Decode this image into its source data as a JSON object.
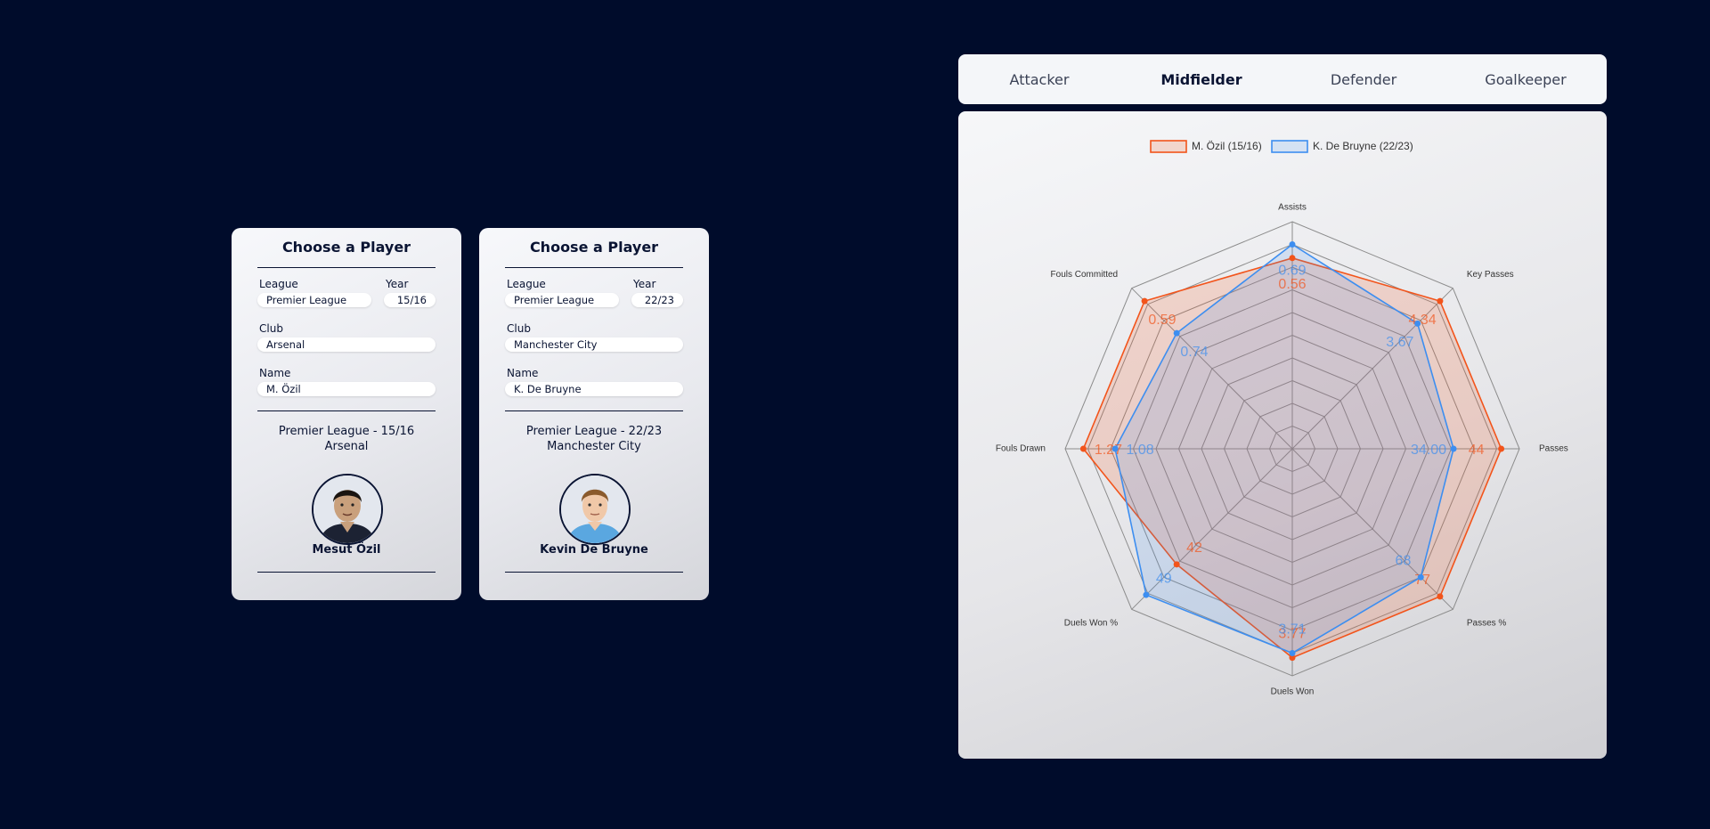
{
  "players": [
    {
      "title": "Choose a Player",
      "league_label": "League",
      "league": "Premier League",
      "year_label": "Year",
      "year": "15/16",
      "club_label": "Club",
      "club": "Arsenal",
      "name_label": "Name",
      "name": "M. Özil",
      "summary_line1": "Premier League - 15/16",
      "summary_line2": "Arsenal",
      "full_name": "Mesut Özil"
    },
    {
      "title": "Choose a Player",
      "league_label": "League",
      "league": "Premier League",
      "year_label": "Year",
      "year": "22/23",
      "club_label": "Club",
      "club": "Manchester City",
      "name_label": "Name",
      "name": "K. De Bruyne",
      "summary_line1": "Premier League - 22/23",
      "summary_line2": "Manchester City",
      "full_name": "Kevin De Bruyne"
    }
  ],
  "tabs": [
    "Attacker",
    "Midfielder",
    "Defender",
    "Goalkeeper"
  ],
  "active_tab": "Midfielder",
  "chart_data": {
    "type": "radar",
    "axes": [
      "Assists",
      "Key Passes",
      "Passes",
      "Passes %",
      "Duels Won",
      "Duels Won %",
      "Fouls Drawn",
      "Fouls Committed"
    ],
    "series": [
      {
        "name": "M. Özil (15/16)",
        "color": "#f2541b",
        "values": [
          0.56,
          4.34,
          44,
          77,
          3.77,
          42,
          1.27,
          0.59
        ],
        "labels": [
          "0.56",
          "4.34",
          "44",
          "77",
          "3.77",
          "42",
          "1.27",
          "0.59"
        ],
        "radius_fraction": [
          0.84,
          0.92,
          0.92,
          0.92,
          0.92,
          0.72,
          0.92,
          0.92
        ]
      },
      {
        "name": "K. De Bruyne (22/23)",
        "color": "#3d8ef0",
        "values": [
          0.69,
          3.67,
          34.0,
          68,
          3.71,
          49,
          1.08,
          0.74
        ],
        "labels": [
          "0.69",
          "3.67",
          "34.00",
          "68",
          "3.71",
          "49",
          "1.08",
          "0.74"
        ],
        "radius_fraction": [
          0.9,
          0.78,
          0.71,
          0.8,
          0.9,
          0.91,
          0.78,
          0.72
        ]
      }
    ],
    "legend_position": "top",
    "grid": true
  }
}
